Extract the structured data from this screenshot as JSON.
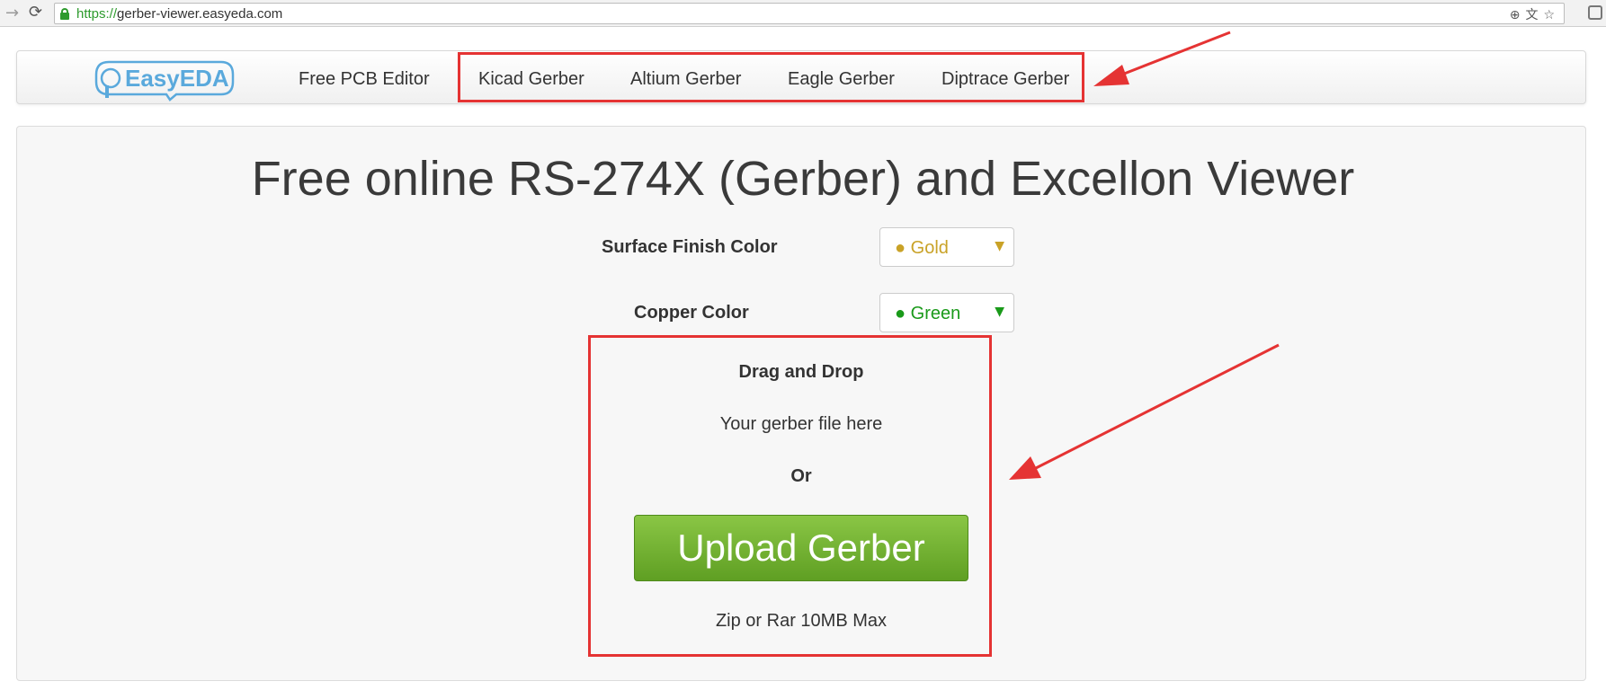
{
  "browser": {
    "url_scheme": "https://",
    "url_rest": "gerber-viewer.easyeda.com"
  },
  "navbar": {
    "logo_text": "EasyEDA",
    "links": [
      "Free PCB Editor",
      "Kicad Gerber",
      "Altium Gerber",
      "Eagle Gerber",
      "Diptrace Gerber"
    ]
  },
  "main": {
    "title": "Free online RS-274X (Gerber) and Excellon Viewer",
    "surface_finish": {
      "label": "Surface Finish Color",
      "value": "● Gold",
      "color": "#c9a227"
    },
    "copper": {
      "label": "Copper Color",
      "value": "● Green",
      "color": "#1a9a1a"
    },
    "drop_zone": {
      "title": "Drag and Drop",
      "subtitle": "Your gerber file here",
      "or": "Or",
      "button": "Upload Gerber",
      "note": "Zip or Rar 10MB Max"
    }
  },
  "colors": {
    "accent_red": "#e53333",
    "button_green": "#6fb030",
    "logo_blue": "#5aa9dc"
  }
}
